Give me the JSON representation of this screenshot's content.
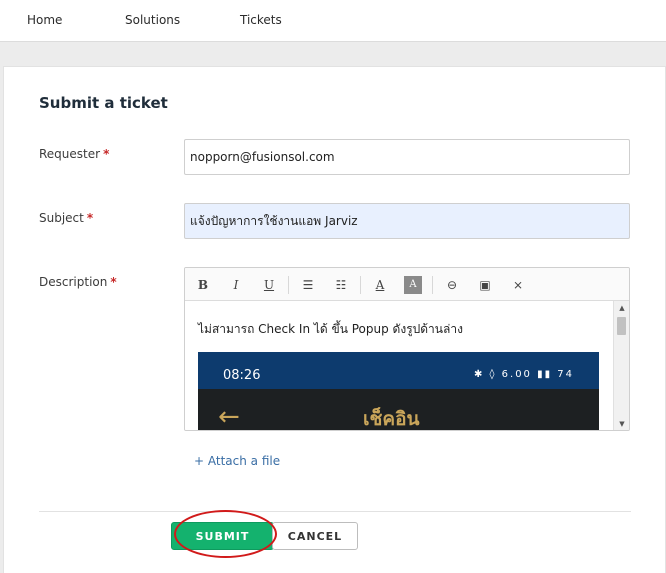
{
  "nav": {
    "items": [
      {
        "label": "Home"
      },
      {
        "label": "Solutions"
      },
      {
        "label": "Tickets"
      }
    ]
  },
  "form": {
    "title": "Submit a ticket",
    "requester": {
      "label": "Requester",
      "required_mark": "*",
      "value": "nopporn@fusionsol.com"
    },
    "subject": {
      "label": "Subject",
      "required_mark": "*",
      "value": "แจ้งปัญหาการใช้งานแอพ Jarviz"
    },
    "description": {
      "label": "Description",
      "required_mark": "*",
      "text": "ไม่สามารถ Check In ได้ ขึ้น Popup ดังรูปด้านล่าง",
      "screenshot": {
        "time": "08:26",
        "status": "✱ ◊ 6.00 ▮▮ 74",
        "back_glyph": "←",
        "title": "เช็คอิน"
      }
    },
    "toolbar": {
      "bold": "B",
      "italic": "I",
      "underline": "U",
      "bullets": "☰",
      "numbered": "☷",
      "font_color": "A",
      "bg_color": "A",
      "link": "⊖",
      "image": "▣",
      "clear": "⨯"
    },
    "attach_label": "+ Attach a file",
    "submit_label": "SUBMIT",
    "cancel_label": "CANCEL"
  },
  "colors": {
    "submit": "#14b26e",
    "accent_link": "#3a6ea5",
    "required": "#c62828",
    "annotation": "#d11a1a"
  }
}
